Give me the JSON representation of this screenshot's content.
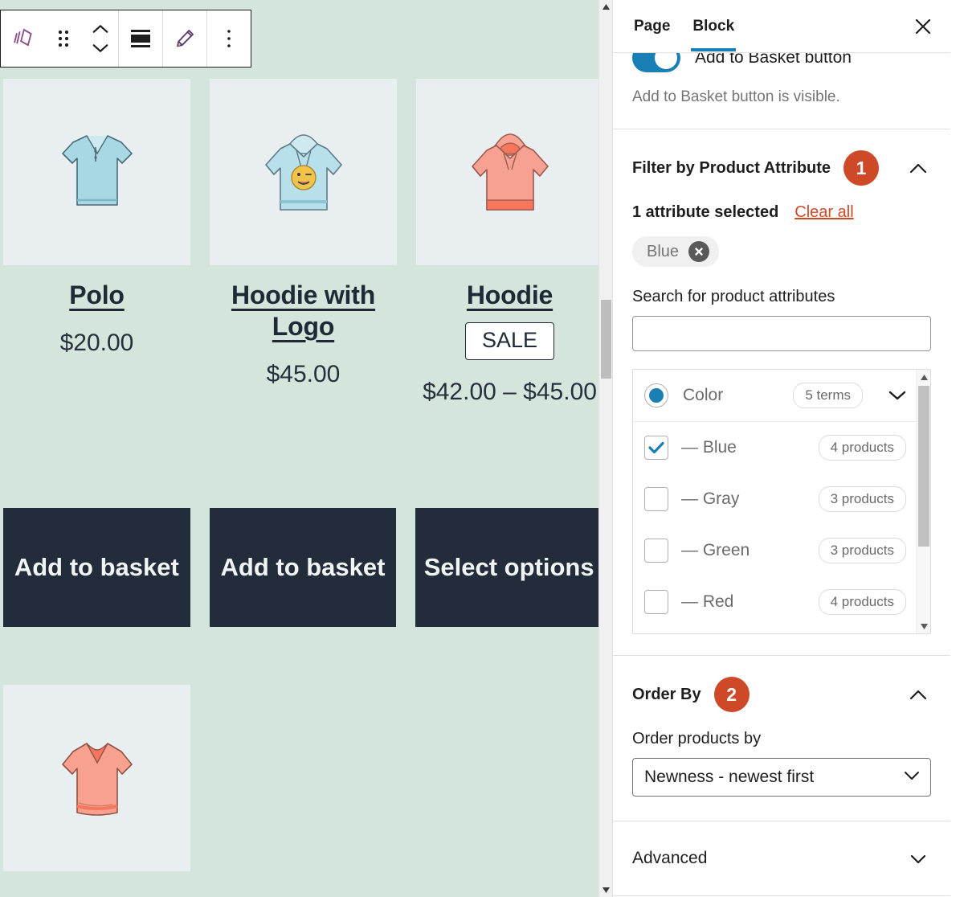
{
  "toolbar": {
    "block_icon": "product-collection-icon",
    "drag_icon": "drag-handle-icon",
    "move_up_icon": "chevron-up-icon",
    "move_down_icon": "chevron-down-icon",
    "align_icon": "align-block-icon",
    "edit_icon": "pencil-edit-icon",
    "options_icon": "more-options-icon"
  },
  "canvas": {
    "background_color": "#d4e5dc",
    "tile_color": "#e9eef0",
    "button_color": "#232c3b",
    "products": [
      {
        "title": "Polo",
        "price": "$20.00",
        "badge": "",
        "action": "Add to basket",
        "image": "polo-shirt-light-blue"
      },
      {
        "title": "Hoodie with Logo",
        "price": "$45.00",
        "badge": "",
        "action": "Add to basket",
        "image": "hoodie-with-emoji-logo-light-blue"
      },
      {
        "title": "Hoodie",
        "price": "$42.00 – $45.00",
        "badge": "SALE",
        "action": "Select options",
        "image": "hoodie-coral"
      }
    ],
    "next_row": [
      {
        "image": "tshirt-coral-vneck"
      }
    ]
  },
  "sidebar": {
    "tabs": [
      {
        "label": "Page",
        "active": false
      },
      {
        "label": "Block",
        "active": true
      }
    ],
    "close_icon": "close-icon",
    "toggle_section": {
      "label": "Add to Basket button",
      "enabled": true,
      "help": "Add to Basket button is visible."
    },
    "filter_section": {
      "title": "Filter by Product Attribute",
      "badge": "1",
      "expanded": true,
      "selected_text": "1 attribute selected",
      "clear_all": "Clear all",
      "chips": [
        {
          "label": "Blue",
          "remove_icon": "remove-circle-icon"
        }
      ],
      "search_label": "Search for product attributes",
      "search_value": "",
      "search_placeholder": "",
      "attribute": {
        "name": "Color",
        "terms_count": "5 terms",
        "selected": true
      },
      "terms": [
        {
          "label": "— Blue",
          "count": "4 products",
          "checked": true
        },
        {
          "label": "— Gray",
          "count": "3 products",
          "checked": false
        },
        {
          "label": "— Green",
          "count": "3 products",
          "checked": false
        },
        {
          "label": "— Red",
          "count": "4 products",
          "checked": false
        }
      ]
    },
    "order_section": {
      "title": "Order By",
      "badge": "2",
      "expanded": true,
      "field_label": "Order products by",
      "selected_value": "Newness - newest first"
    },
    "advanced_section": {
      "title": "Advanced",
      "expanded": false
    }
  },
  "colors": {
    "accent_blue": "#1a7fb5",
    "badge_red": "#ce4927",
    "link_red": "#ce4927"
  }
}
